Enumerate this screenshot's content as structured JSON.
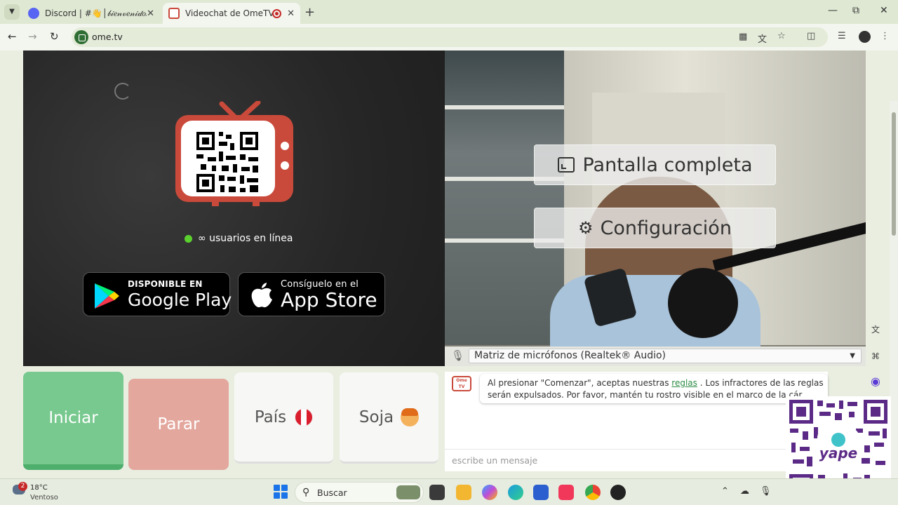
{
  "browser": {
    "tabs": [
      {
        "title": "Discord | #👋│𝒷𝒾𝑒𝓃𝓋𝑒𝓃𝒾𝒹𝑜𝓈",
        "active": false
      },
      {
        "title": "Videochat de OmeTV: una",
        "active": true
      }
    ],
    "url": "ome.tv",
    "new_tab": "+",
    "close": "✕",
    "window_controls": {
      "minimize": "—",
      "maximize": "⧉",
      "close": "✕"
    }
  },
  "page": {
    "online_text": "∞ usuarios en línea",
    "google_play": {
      "small": "DISPONIBLE EN",
      "big": "Google Play"
    },
    "app_store": {
      "small": "Consíguelo en el",
      "big": "App Store"
    },
    "fullscreen_label": "Pantalla completa",
    "settings_label": "Configuración",
    "microphone": "Matriz de micrófonos (Realtek® Audio)",
    "buttons": {
      "start": "Iniciar",
      "stop": "Parar",
      "country": "País",
      "gender": "Soja"
    },
    "chat": {
      "logo": "Ome TV",
      "message_before": "Al presionar \"Comenzar\", aceptas nuestras ",
      "message_link": "reglas",
      "message_after": " . Los infractores de las reglas",
      "message_line2": "serán expulsados. Por favor, mantén tu rostro visible en el marco de la cár",
      "input_placeholder": "escribe un mensaje"
    }
  },
  "taskbar": {
    "weather_temp": "18°C",
    "weather_desc": "Ventoso",
    "weather_badge": "2",
    "search_label": "Buscar"
  },
  "colors": {
    "start": "#78c98f",
    "stop": "#e3a79d",
    "ometv_red": "#c94a3b",
    "online_dot": "#5bd12f"
  }
}
